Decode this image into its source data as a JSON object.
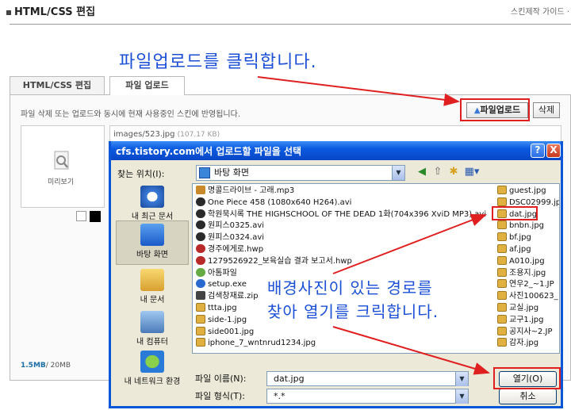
{
  "page": {
    "title": "HTML/CSS 편집",
    "guide_link": "스킨제작 가이드",
    "tabs": [
      {
        "label": "HTML/CSS 편집"
      },
      {
        "label": "파일 업로드"
      }
    ],
    "description": "파일 삭제 또는 업로드와 동시에 현재 사용중인 스킨에 반영됩니다.",
    "upload_button": "파일업로드",
    "delete_button": "삭제",
    "preview_label": "미리보기",
    "first_file": "images/523.jpg",
    "first_file_size": "(107.17 KB)",
    "quota_used": "1.5MB",
    "quota_total": "/ 20MB"
  },
  "annotations": {
    "top": "파일업로드를 클릭합니다.",
    "bottom_line1": "배경사진이 있는 경로를",
    "bottom_line2": "찾아 열기를 크릭합니다."
  },
  "dialog": {
    "title": "cfs.tistory.com에서 업로드할 파일을 선택",
    "help": "?",
    "close": "X",
    "look_in_label": "찾는 위치(I):",
    "look_in_value": "바탕 화면",
    "places": [
      {
        "label": "내 최근 문서",
        "icon": "recent-docs-icon"
      },
      {
        "label": "바탕 화면",
        "icon": "desktop-icon"
      },
      {
        "label": "내 문서",
        "icon": "my-documents-icon"
      },
      {
        "label": "내 컴퓨터",
        "icon": "my-computer-icon"
      },
      {
        "label": "내 네트워크 환경",
        "icon": "network-icon"
      }
    ],
    "files_left": [
      {
        "name": "명콜드라이브 - 고래.mp3",
        "type": "mp3"
      },
      {
        "name": "One Piece 458 (1080x640 H264).avi",
        "type": "avi"
      },
      {
        "name": "학원묵시록 THE HIGHSCHOOL OF THE DEAD 1화(704x396 XviD MP3).avi",
        "type": "avi"
      },
      {
        "name": "원피스0325.avi",
        "type": "avi"
      },
      {
        "name": "원피스0324.avi",
        "type": "avi"
      },
      {
        "name": "경주에게로.hwp",
        "type": "hwp"
      },
      {
        "name": "1279526922_보육실습 결과 보고서.hwp",
        "type": "hwp"
      },
      {
        "name": "아톰파일",
        "type": "folder"
      },
      {
        "name": "setup.exe",
        "type": "exe"
      },
      {
        "name": "검색창재료.zip",
        "type": "zip"
      },
      {
        "name": "ttta.jpg",
        "type": "jpg"
      },
      {
        "name": "side-1.jpg",
        "type": "jpg"
      },
      {
        "name": "side001.jpg",
        "type": "jpg"
      },
      {
        "name": "iphone_7_wntnrud1234.jpg",
        "type": "jpg"
      }
    ],
    "files_right": [
      {
        "name": "guest.jpg",
        "type": "jpg"
      },
      {
        "name": "DSC02999.jp",
        "type": "jpg"
      },
      {
        "name": "dat.jpg",
        "type": "jpg"
      },
      {
        "name": "bnbn.jpg",
        "type": "jpg"
      },
      {
        "name": "bf.jpg",
        "type": "jpg"
      },
      {
        "name": "af.jpg",
        "type": "jpg"
      },
      {
        "name": "A010.jpg",
        "type": "jpg"
      },
      {
        "name": "조용지.jpg",
        "type": "jpg"
      },
      {
        "name": "연우2_~1.JP",
        "type": "jpg"
      },
      {
        "name": "사진100623_",
        "type": "jpg"
      },
      {
        "name": "교실.jpg",
        "type": "jpg"
      },
      {
        "name": "교구1.jpg",
        "type": "jpg"
      },
      {
        "name": "공지사~2.JP",
        "type": "jpg"
      },
      {
        "name": "감자.jpg",
        "type": "jpg"
      }
    ],
    "filename_label": "파일 이름(N):",
    "filename_value": "dat.jpg",
    "filetype_label": "파일 형식(T):",
    "filetype_value": "*.*",
    "open_button": "열기(O)",
    "cancel_button": "취소"
  },
  "colors": {
    "annotation": "#1a4fd6",
    "highlight": "#e02020",
    "xp_title": "#0a56d8"
  }
}
